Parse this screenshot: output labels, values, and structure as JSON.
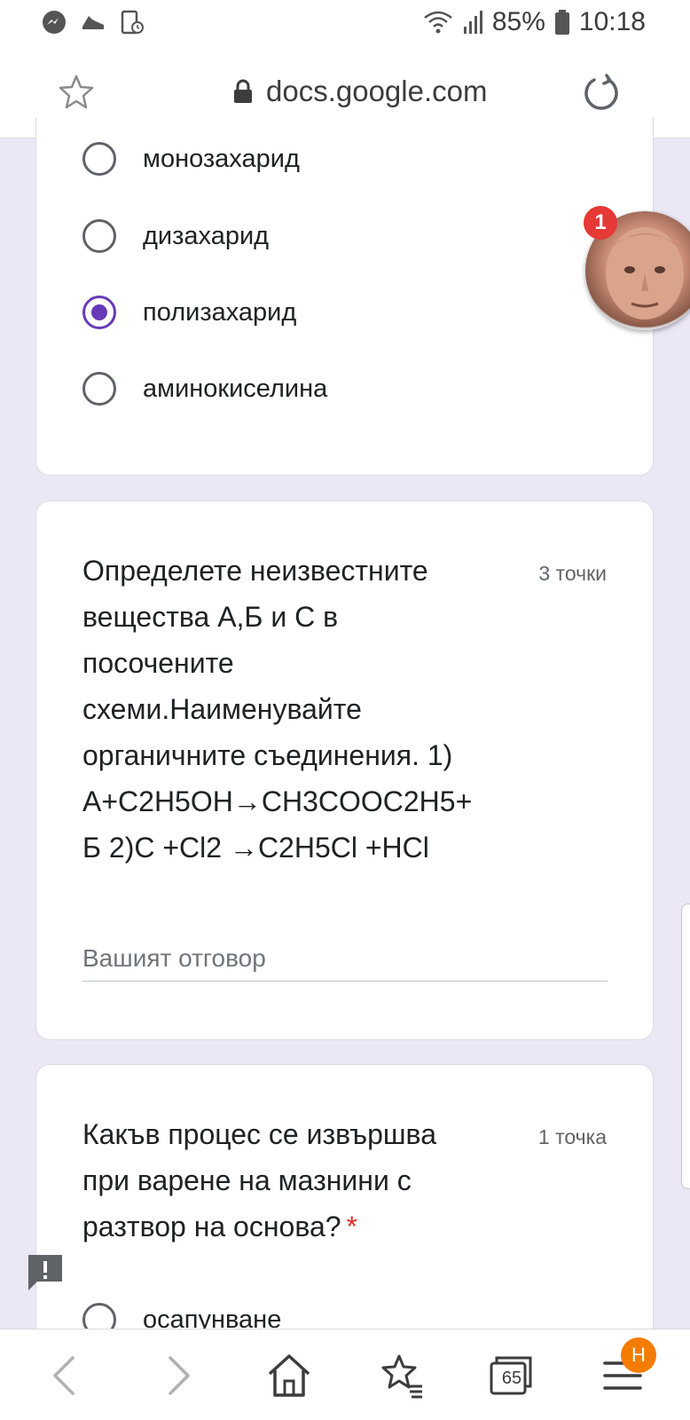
{
  "status_bar": {
    "battery": "85%",
    "time": "10:18",
    "left_icons": [
      "messenger-icon",
      "sneaker-icon",
      "screen-record-icon"
    ]
  },
  "url_bar": {
    "domain": "docs.google.com"
  },
  "question1": {
    "options": [
      {
        "label": "монозахарид",
        "selected": false
      },
      {
        "label": "дизахарид",
        "selected": false
      },
      {
        "label": "полизахарид",
        "selected": true
      },
      {
        "label": "аминокиселина",
        "selected": false
      }
    ]
  },
  "question2": {
    "title_lines": [
      "Определете неизвестните",
      "вещества А,Б и С в",
      "посочените",
      "схеми.Наименувайте",
      "органичните съединения. 1)",
      "А+C2H5OH→CH3COOC2H5+",
      "Б 2)C +Cl2 →C2H5Cl +HCl"
    ],
    "points": "3 точки",
    "answer_placeholder": "Вашият отговор"
  },
  "question3": {
    "title_lines": [
      "Какъв процес се извършва",
      "при варене на мазнини с",
      "разтвор на основа?"
    ],
    "required_mark": "*",
    "points": "1 точка",
    "options": [
      {
        "label": "осапунване",
        "selected": false
      }
    ]
  },
  "chat_head": {
    "badge_count": "1"
  },
  "bottom_nav": {
    "tabs_count": "65",
    "menu_badge": "H"
  },
  "colors": {
    "accent": "#673ab7",
    "background": "#ebe7f5",
    "required": "#d93025"
  }
}
